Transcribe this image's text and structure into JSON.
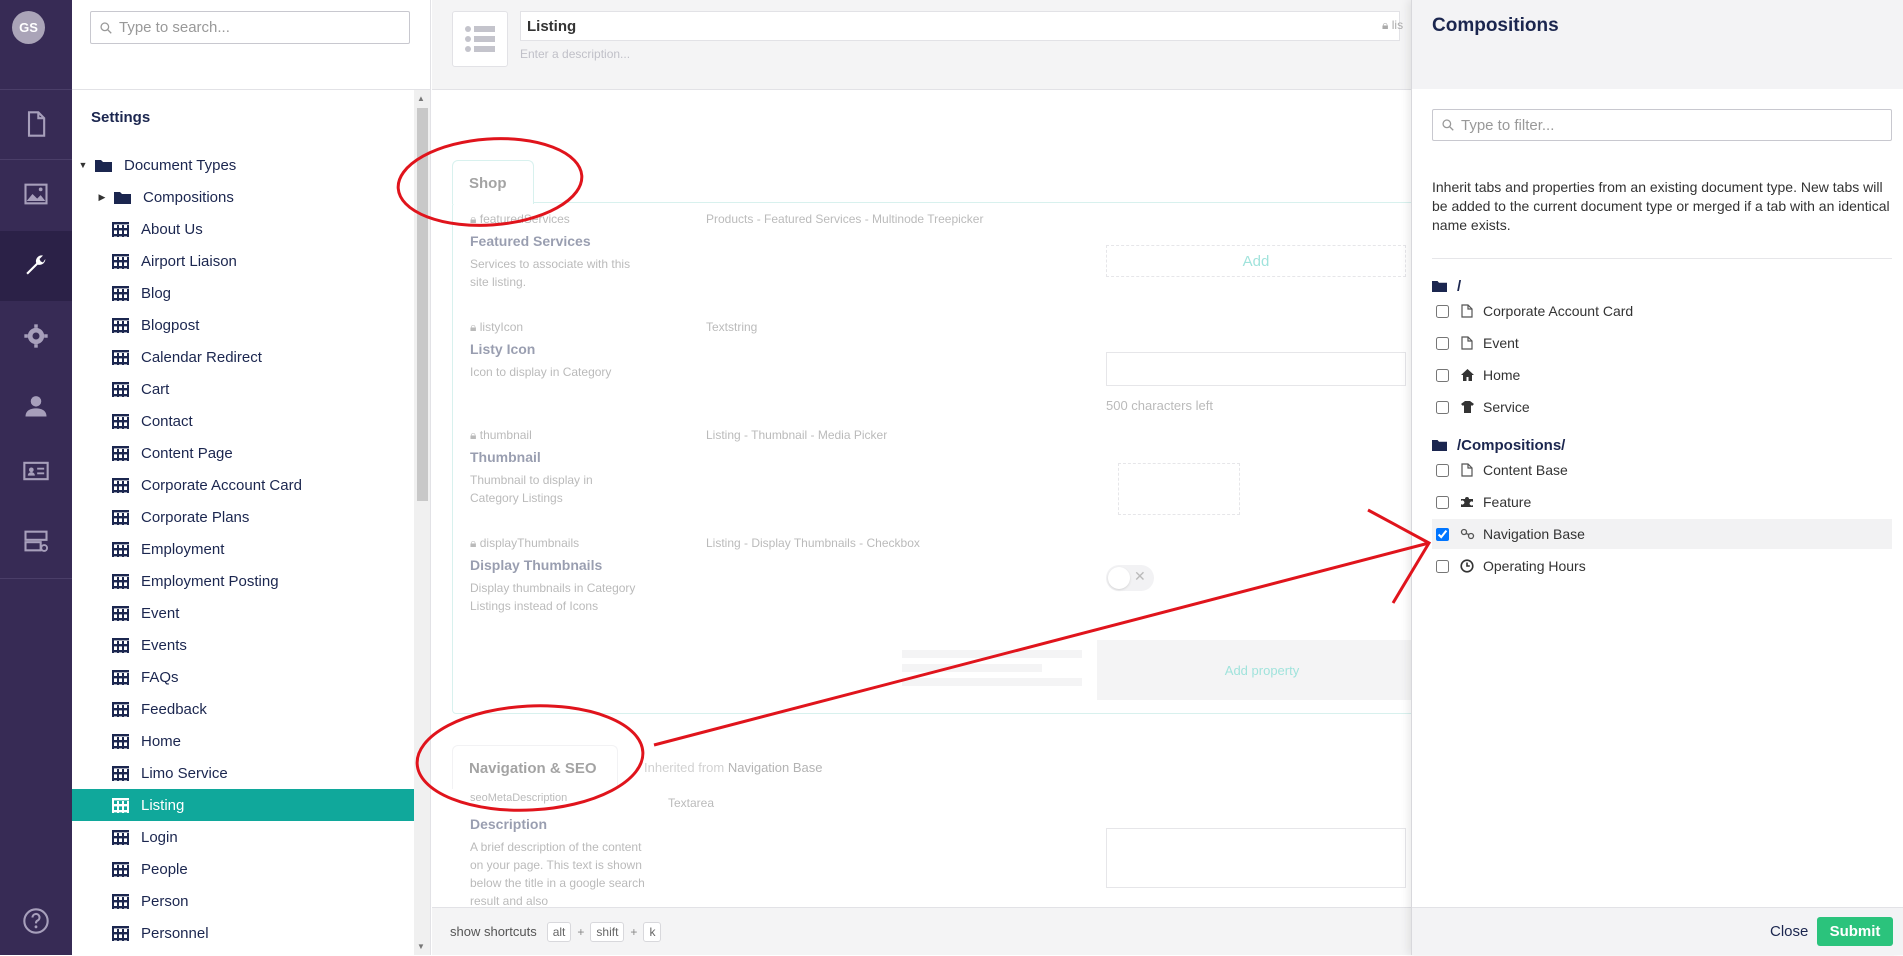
{
  "user": {
    "initials": "GS"
  },
  "search": {
    "placeholder": "Type to search..."
  },
  "tree": {
    "title": "Settings",
    "root_label": "Document Types",
    "items": [
      {
        "label": "Compositions",
        "type": "folder"
      },
      {
        "label": "About Us",
        "type": "doc"
      },
      {
        "label": "Airport Liaison",
        "type": "doc"
      },
      {
        "label": "Blog",
        "type": "doc"
      },
      {
        "label": "Blogpost",
        "type": "doc"
      },
      {
        "label": "Calendar Redirect",
        "type": "doc"
      },
      {
        "label": "Cart",
        "type": "doc"
      },
      {
        "label": "Contact",
        "type": "doc"
      },
      {
        "label": "Content Page",
        "type": "doc"
      },
      {
        "label": "Corporate Account Card",
        "type": "doc"
      },
      {
        "label": "Corporate Plans",
        "type": "doc"
      },
      {
        "label": "Employment",
        "type": "doc"
      },
      {
        "label": "Employment Posting",
        "type": "doc"
      },
      {
        "label": "Event",
        "type": "doc"
      },
      {
        "label": "Events",
        "type": "doc"
      },
      {
        "label": "FAQs",
        "type": "doc"
      },
      {
        "label": "Feedback",
        "type": "doc"
      },
      {
        "label": "Home",
        "type": "doc"
      },
      {
        "label": "Limo Service",
        "type": "doc"
      },
      {
        "label": "Listing",
        "type": "doc",
        "selected": true
      },
      {
        "label": "Login",
        "type": "doc"
      },
      {
        "label": "People",
        "type": "doc"
      },
      {
        "label": "Person",
        "type": "doc"
      },
      {
        "label": "Personnel",
        "type": "doc"
      }
    ]
  },
  "editor": {
    "name": "Listing",
    "alias_short": "lis",
    "description_placeholder": "Enter a description...",
    "tab1": "Shop",
    "properties": [
      {
        "alias": "featuredServices",
        "name": "Featured Services",
        "description": "Services to associate with this site listing.",
        "editor": "Products - Featured Services - Multinode Treepicker"
      },
      {
        "alias": "listyIcon",
        "name": "Listy Icon",
        "description": "Icon to display in Category",
        "editor": "Textstring"
      },
      {
        "alias": "thumbnail",
        "name": "Thumbnail",
        "description": "Thumbnail to display in Category Listings",
        "editor": "Listing - Thumbnail - Media Picker"
      },
      {
        "alias": "displayThumbnails",
        "name": "Display Thumbnails",
        "description": "Display thumbnails in Category Listings instead of Icons",
        "editor": "Listing - Display Thumbnails - Checkbox"
      }
    ],
    "add_label": "Add",
    "chars_left": "500 characters left",
    "add_property": "Add property",
    "tab2": "Navigation & SEO",
    "inherited_prefix": "Inherited from",
    "inherited_from": "Navigation Base",
    "prop2": {
      "alias": "seoMetaDescription",
      "name": "Description",
      "description": "A brief description of the content on your page. This text is shown below the title in a google search result and also",
      "editor": "Textarea"
    },
    "shortcuts": {
      "label": "show shortcuts",
      "k1": "alt",
      "k2": "shift",
      "k3": "k",
      "plus": "+"
    }
  },
  "compositions": {
    "title": "Compositions",
    "filter_placeholder": "Type to filter...",
    "description": "Inherit tabs and properties from an existing document type. New tabs will be added to the current document type or merged if a tab with an identical name exists.",
    "groups": [
      {
        "folder": "/",
        "items": [
          {
            "label": "Corporate Account Card",
            "icon": "document-icon",
            "checked": false
          },
          {
            "label": "Event",
            "icon": "document-icon",
            "checked": false
          },
          {
            "label": "Home",
            "icon": "home-icon",
            "checked": false
          },
          {
            "label": "Service",
            "icon": "service-icon",
            "checked": false
          }
        ]
      },
      {
        "folder": "/Compositions/",
        "items": [
          {
            "label": "Content Base",
            "icon": "document-icon",
            "checked": false
          },
          {
            "label": "Feature",
            "icon": "puzzle-icon",
            "checked": false
          },
          {
            "label": "Navigation Base",
            "icon": "link-icon",
            "checked": true
          },
          {
            "label": "Operating Hours",
            "icon": "clock-icon",
            "checked": false
          }
        ]
      }
    ],
    "close_label": "Close",
    "submit_label": "Submit"
  },
  "colors": {
    "rail": "#372b55",
    "selected": "#10a89b",
    "submit": "#2bc37c",
    "annotation": "#e0141c",
    "accent": "#2bc0b0"
  }
}
